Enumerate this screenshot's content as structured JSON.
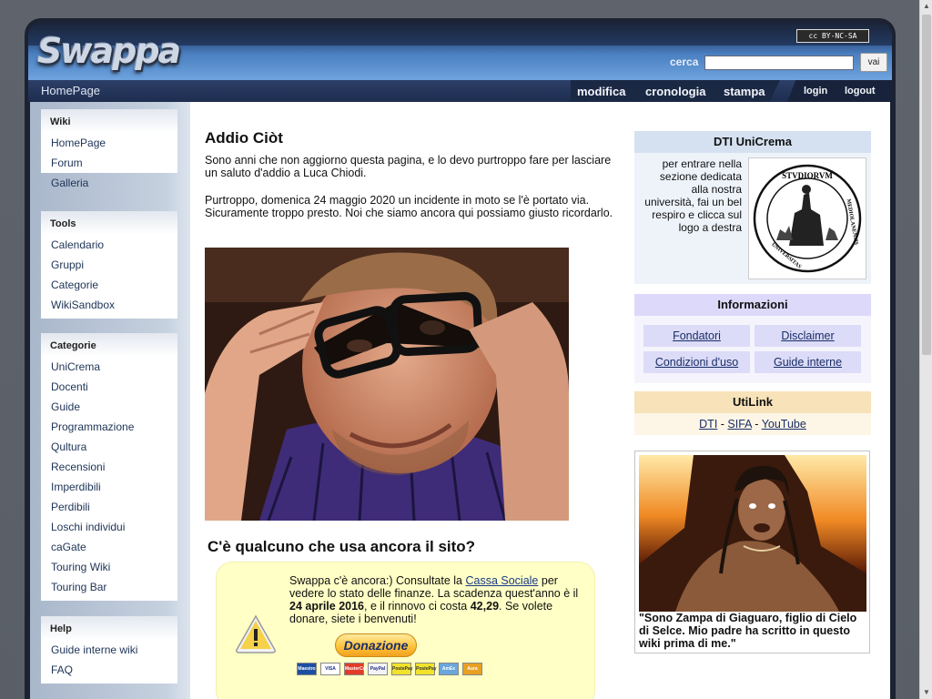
{
  "site": {
    "logo_text": "Swappa",
    "license_badge": "cc BY-NC-SA"
  },
  "search": {
    "label": "cerca",
    "value": "",
    "button_label": "vai"
  },
  "navbar": {
    "page_name": "HomePage",
    "tabs": [
      "modifica",
      "cronologia",
      "stampa"
    ],
    "user_links": [
      "login",
      "logout"
    ]
  },
  "sidebar": {
    "wiki": {
      "title": "Wiki",
      "items": [
        "HomePage",
        "Forum",
        "Galleria"
      ]
    },
    "tools": {
      "title": "Tools",
      "items": [
        "Calendario",
        "Gruppi",
        "Categorie",
        "WikiSandbox"
      ]
    },
    "categorie": {
      "title": "Categorie",
      "items": [
        "UniCrema",
        "Docenti",
        "Guide",
        "Programmazione",
        "Qultura",
        "Recensioni",
        "Imperdibili",
        "Perdibili",
        "Loschi individui",
        "caGate",
        "Touring Wiki",
        "Touring Bar"
      ]
    },
    "help": {
      "title": "Help",
      "items": [
        "Guide interne wiki",
        "FAQ"
      ]
    }
  },
  "main": {
    "title": "Addio Ciòt",
    "para1": "Sono anni che non aggiorno questa pagina, e lo devo purtroppo fare per lasciare un saluto d'addio a Luca Chiodi.",
    "para2": "Purtroppo, domenica 24 maggio 2020 un incidente in moto se l'è portato via. Sicuramente troppo presto. Noi che siamo ancora qui possiamo giusto ricordarlo.",
    "section2_title": "C'è qualcuno che usa ancora il sito?",
    "donate": {
      "text_before_link": "Swappa c'è ancora:) Consultate la ",
      "link_text": "Cassa Sociale",
      "text_after_link": " per vedere lo stato delle finanze. La scadenza quest'anno è il ",
      "deadline": "24 aprile 2016",
      "text_mid": ", e il rinnovo ci costa ",
      "amount": "42,29",
      "text_end": ". Se volete donare, siete i benvenuti!",
      "button_label": "Donazione",
      "cards": [
        {
          "name": "Maestro",
          "color": "#1d4fa0"
        },
        {
          "name": "VISA",
          "color": "#ffffff"
        },
        {
          "name": "MasterCard",
          "color": "#e23b2a"
        },
        {
          "name": "PayPal",
          "color": "#f3f3f3"
        },
        {
          "name": "PostePay",
          "color": "#f2e22a"
        },
        {
          "name": "PostePay",
          "color": "#f2e22a"
        },
        {
          "name": "AmEx",
          "color": "#6aa6da"
        },
        {
          "name": "Aura",
          "color": "#e8a023"
        }
      ]
    }
  },
  "right": {
    "dti": {
      "title": "DTI UniCrema",
      "text": "per entrare nella sezione dedicata alla nostra università, fai un bel respiro e clicca sul logo a destra",
      "seal_text_top": "STVDIORVM",
      "seal_text_side": "MEDIOLANENSIS",
      "seal_text_bottom": "UNIVERSITAS"
    },
    "info": {
      "title": "Informazioni",
      "links": [
        "Fondatori",
        "Disclaimer",
        "Condizioni d'uso",
        "Guide interne"
      ]
    },
    "utilink": {
      "title": "UtiLink",
      "links": [
        "DTI",
        "SIFA",
        "YouTube"
      ],
      "separator": " - "
    },
    "quote": {
      "text": "\"Sono Zampa di Giaguaro, figlio di Cielo di Selce. Mio padre ha scritto in questo wiki prima di me.\""
    }
  },
  "colors": {
    "dti_header": "#d5e1f1",
    "info_header": "#dcd9fa",
    "utilink_header": "#f7e2b9",
    "donate_bg": "#ffffc6",
    "link": "#1a2d66"
  }
}
